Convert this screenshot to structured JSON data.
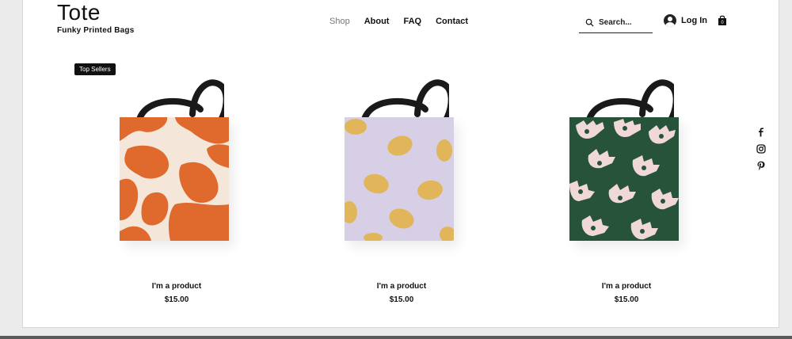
{
  "brand": {
    "title": "Tote",
    "subtitle": "Funky Printed Bags"
  },
  "nav": {
    "items": [
      {
        "label": "Shop",
        "active": true
      },
      {
        "label": "About",
        "active": false
      },
      {
        "label": "FAQ",
        "active": false
      },
      {
        "label": "Contact",
        "active": false
      }
    ]
  },
  "search": {
    "placeholder": "Search..."
  },
  "login": {
    "label": "Log In"
  },
  "badge": {
    "label": "Top Sellers"
  },
  "products": [
    {
      "name": "I'm a product",
      "price": "$15.00",
      "pattern": "orange-brush"
    },
    {
      "name": "I'm a product",
      "price": "$15.00",
      "pattern": "lemons"
    },
    {
      "name": "I'm a product",
      "price": "$15.00",
      "pattern": "green-hands"
    }
  ],
  "social": [
    "facebook-icon",
    "instagram-icon",
    "pinterest-icon"
  ],
  "colors": {
    "orange": "#e06a2d",
    "lavender": "#d7cfe6",
    "lemon": "#e1b65a",
    "green": "#26533a",
    "strap": "#1a1a1a"
  }
}
